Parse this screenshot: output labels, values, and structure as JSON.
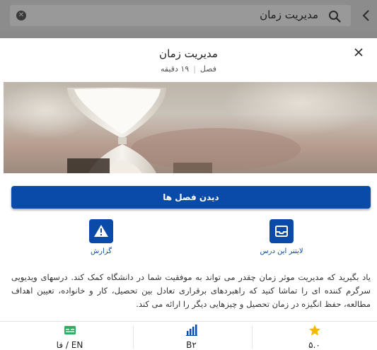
{
  "search": {
    "query": "مدیریت زمان"
  },
  "sheet": {
    "title": "مدیریت زمان",
    "meta_type": "فصل",
    "meta_duration": "۱۹ دقیقه"
  },
  "cta": {
    "label": "دیدن فصل ها"
  },
  "actions": [
    {
      "label": "لایتنر این درس",
      "icon": "inbox-icon"
    },
    {
      "label": "گزارش",
      "icon": "warning-icon"
    }
  ],
  "description": "یاد بگیرید که مدیریت موثر زمان چقدر می تواند به موفقیت شما در دانشگاه کمک کند. درسهای ویدیویی سرگرم کننده ای را تماشا کنید که راهبردهای برقراری تعادل بین تحصیل، کار و خانواده، تعیین اهداف مطالعه، حفظ انگیزه در زمان تحصیل و چیزهایی دیگر را ارائه می کند.",
  "footer": {
    "rating": "۵.۰",
    "level": "B۲",
    "language": "فا / EN"
  },
  "colors": {
    "accent": "#0a4aa8",
    "star": "#f5b800",
    "lang": "#2fae62"
  }
}
